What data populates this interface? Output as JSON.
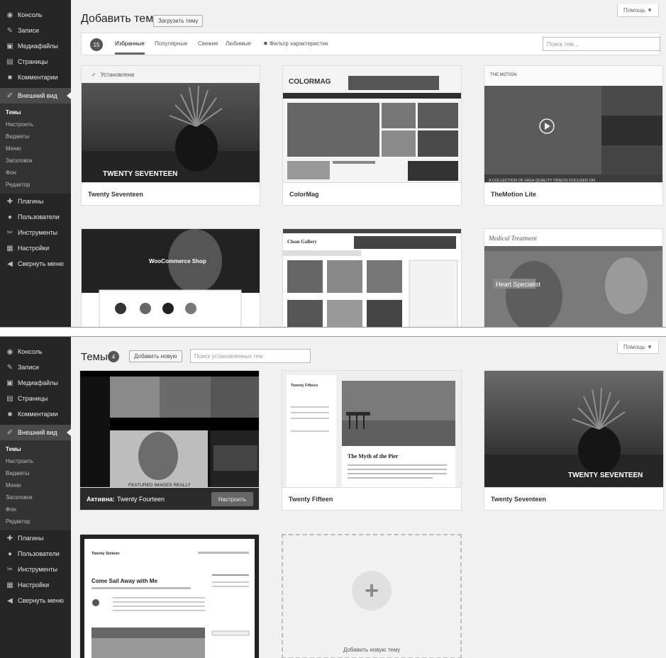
{
  "sidebar": {
    "items": [
      {
        "label": "Консоль",
        "icon": "dashboard-icon"
      },
      {
        "label": "Записи",
        "icon": "pin-icon"
      },
      {
        "label": "Медиафайлы",
        "icon": "media-icon"
      },
      {
        "label": "Страницы",
        "icon": "page-icon"
      },
      {
        "label": "Комментарии",
        "icon": "comment-icon"
      },
      {
        "label": "Внешний вид",
        "icon": "brush-icon"
      }
    ],
    "submenu": [
      "Темы",
      "Настроить",
      "Виджеты",
      "Меню",
      "Заголовок",
      "Фон",
      "Редактор"
    ],
    "items_after": [
      {
        "label": "Плагины",
        "icon": "plugin-icon"
      },
      {
        "label": "Пользователи",
        "icon": "users-icon"
      },
      {
        "label": "Инструменты",
        "icon": "tools-icon"
      },
      {
        "label": "Настройки",
        "icon": "settings-icon"
      },
      {
        "label": "Свернуть меню",
        "icon": "collapse-icon"
      }
    ]
  },
  "help_label": "Помощь ▼",
  "add_themes": {
    "title": "Добавить темы",
    "upload_label": "Загрузить тему",
    "count": "15",
    "filters": [
      "Избранные",
      "Популярные",
      "Свежие",
      "Любимые"
    ],
    "feature_filter": "Фильтр характеристик",
    "search_placeholder": "Поиск тем...",
    "installed_label": "Установлена",
    "themes": [
      "Twenty Seventeen",
      "ColorMag",
      "TheMotion Lite",
      "",
      "",
      ""
    ],
    "thumb_text": {
      "seventeen": "TWENTY SEVENTEEN",
      "colormag": "COLORMAG",
      "themotion_brand": "THE.MOTION",
      "themotion_caption": "A COLLECTION OF HIGH QUALITY VIDEOS FOCUSED ON",
      "woocommerce": "WooCommerce Shop",
      "clean_gallery": "Clean Gallery",
      "medical_title": "Medical Treatment",
      "medical_banner": "Heart Specialist"
    }
  },
  "installed_themes": {
    "title": "Темы",
    "count": "4",
    "add_new_label": "Добавить новую",
    "search_placeholder": "Поиск установленных тем",
    "active_prefix": "Активна:",
    "active_name": "Twenty Fourteen",
    "customize_label": "Настроить",
    "themes": [
      "Twenty Fifteen",
      "Twenty Seventeen"
    ],
    "thumb_text": {
      "fourteen": "FEATURED IMAGES REALLY",
      "fifteen_site": "Twenty Fifteen",
      "fifteen_post": "The Myth of the Pier",
      "seventeen": "TWENTY SEVENTEEN",
      "sixteen_site": "Twenty Sixteen",
      "sixteen_post": "Come Sail Away with Me"
    },
    "add_new_tile_label": "Добавить новую тему"
  }
}
